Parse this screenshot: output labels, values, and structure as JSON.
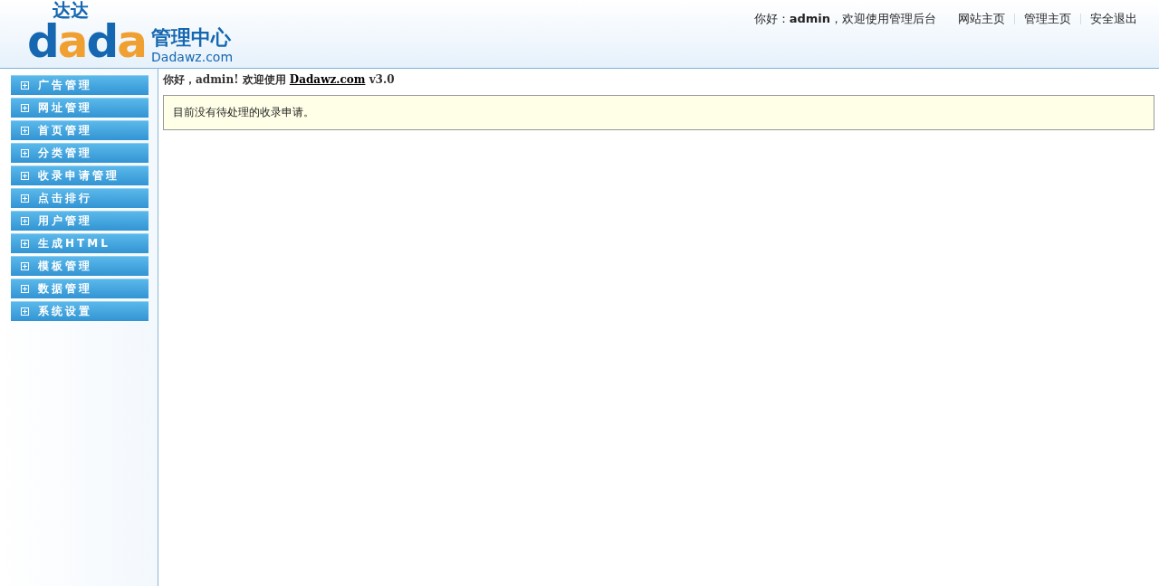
{
  "logo": {
    "top": "达达",
    "mark": "dada",
    "title": "管理中心",
    "domain": "Dadawz.com"
  },
  "header": {
    "greeting": "你好：**admin**，欢迎使用管理后台",
    "links": [
      "网站主页",
      "管理主页",
      "安全退出"
    ]
  },
  "sidebar": {
    "items": [
      {
        "label": "广告管理",
        "expanded": false
      },
      {
        "label": "网址管理",
        "expanded": false
      },
      {
        "label": "首页管理",
        "expanded": false
      },
      {
        "label": "分类管理",
        "expanded": false
      },
      {
        "label": "收录申请管理",
        "expanded": false
      },
      {
        "label": "点击排行",
        "expanded": false
      },
      {
        "label": "用户管理",
        "expanded": false
      },
      {
        "label": "生成HTML",
        "expanded": false
      },
      {
        "label": "模板管理",
        "expanded": false
      },
      {
        "label": "数据管理",
        "expanded": false
      },
      {
        "label": "系统设置",
        "expanded": false
      }
    ]
  },
  "main": {
    "welcome_prefix": "你好，admin! 欢迎使用",
    "site_link": "Dadawz.com",
    "version": "v3.0",
    "notice": "目前没有待处理的收录申请。"
  }
}
